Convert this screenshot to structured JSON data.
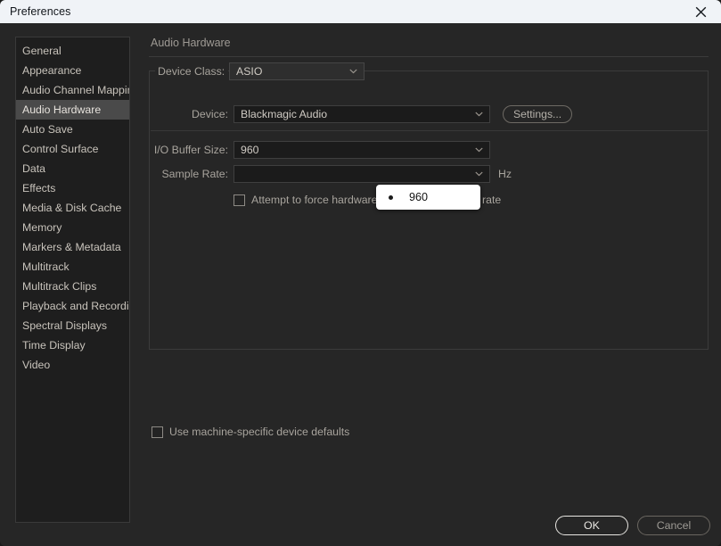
{
  "window": {
    "title": "Preferences",
    "close_icon": "close-icon"
  },
  "sidebar": {
    "items": [
      {
        "label": "General",
        "selected": false
      },
      {
        "label": "Appearance",
        "selected": false
      },
      {
        "label": "Audio Channel Mapping",
        "selected": false
      },
      {
        "label": "Audio Hardware",
        "selected": true
      },
      {
        "label": "Auto Save",
        "selected": false
      },
      {
        "label": "Control Surface",
        "selected": false
      },
      {
        "label": "Data",
        "selected": false
      },
      {
        "label": "Effects",
        "selected": false
      },
      {
        "label": "Media & Disk Cache",
        "selected": false
      },
      {
        "label": "Memory",
        "selected": false
      },
      {
        "label": "Markers & Metadata",
        "selected": false
      },
      {
        "label": "Multitrack",
        "selected": false
      },
      {
        "label": "Multitrack Clips",
        "selected": false
      },
      {
        "label": "Playback and Recording",
        "selected": false
      },
      {
        "label": "Spectral Displays",
        "selected": false
      },
      {
        "label": "Time Display",
        "selected": false
      },
      {
        "label": "Video",
        "selected": false
      }
    ]
  },
  "main": {
    "heading": "Audio Hardware",
    "device_class": {
      "label": "Device Class:",
      "value": "ASIO",
      "arrow_icon": "chevron-down-icon"
    },
    "device": {
      "label": "Device:",
      "value": "Blackmagic Audio",
      "arrow_icon": "chevron-down-icon",
      "settings_button": "Settings..."
    },
    "io_buffer": {
      "label": "I/O Buffer Size:",
      "value": "960",
      "arrow_icon": "chevron-down-icon"
    },
    "sample_rate": {
      "label": "Sample Rate:",
      "value": "",
      "unit": "Hz",
      "arrow_icon": "chevron-down-icon"
    },
    "force_sample_rate": {
      "label": "Attempt to force hardware to document sample rate",
      "checked": false
    },
    "machine_defaults": {
      "label": "Use machine-specific device defaults",
      "checked": false
    }
  },
  "dropdown": {
    "open": true,
    "selected_option": "960",
    "options": [
      "960"
    ]
  },
  "footer": {
    "ok_label": "OK",
    "cancel_label": "Cancel"
  },
  "colors": {
    "window_bg": "#262626",
    "titlebar_bg": "#f0f3f7",
    "panel_bg": "#1e1e1e",
    "selection": "#4a4a4a",
    "text": "#c8c3bb",
    "muted_text": "#9e9a94",
    "field_bg": "#1b1b1b",
    "popup_bg": "#ffffff"
  }
}
